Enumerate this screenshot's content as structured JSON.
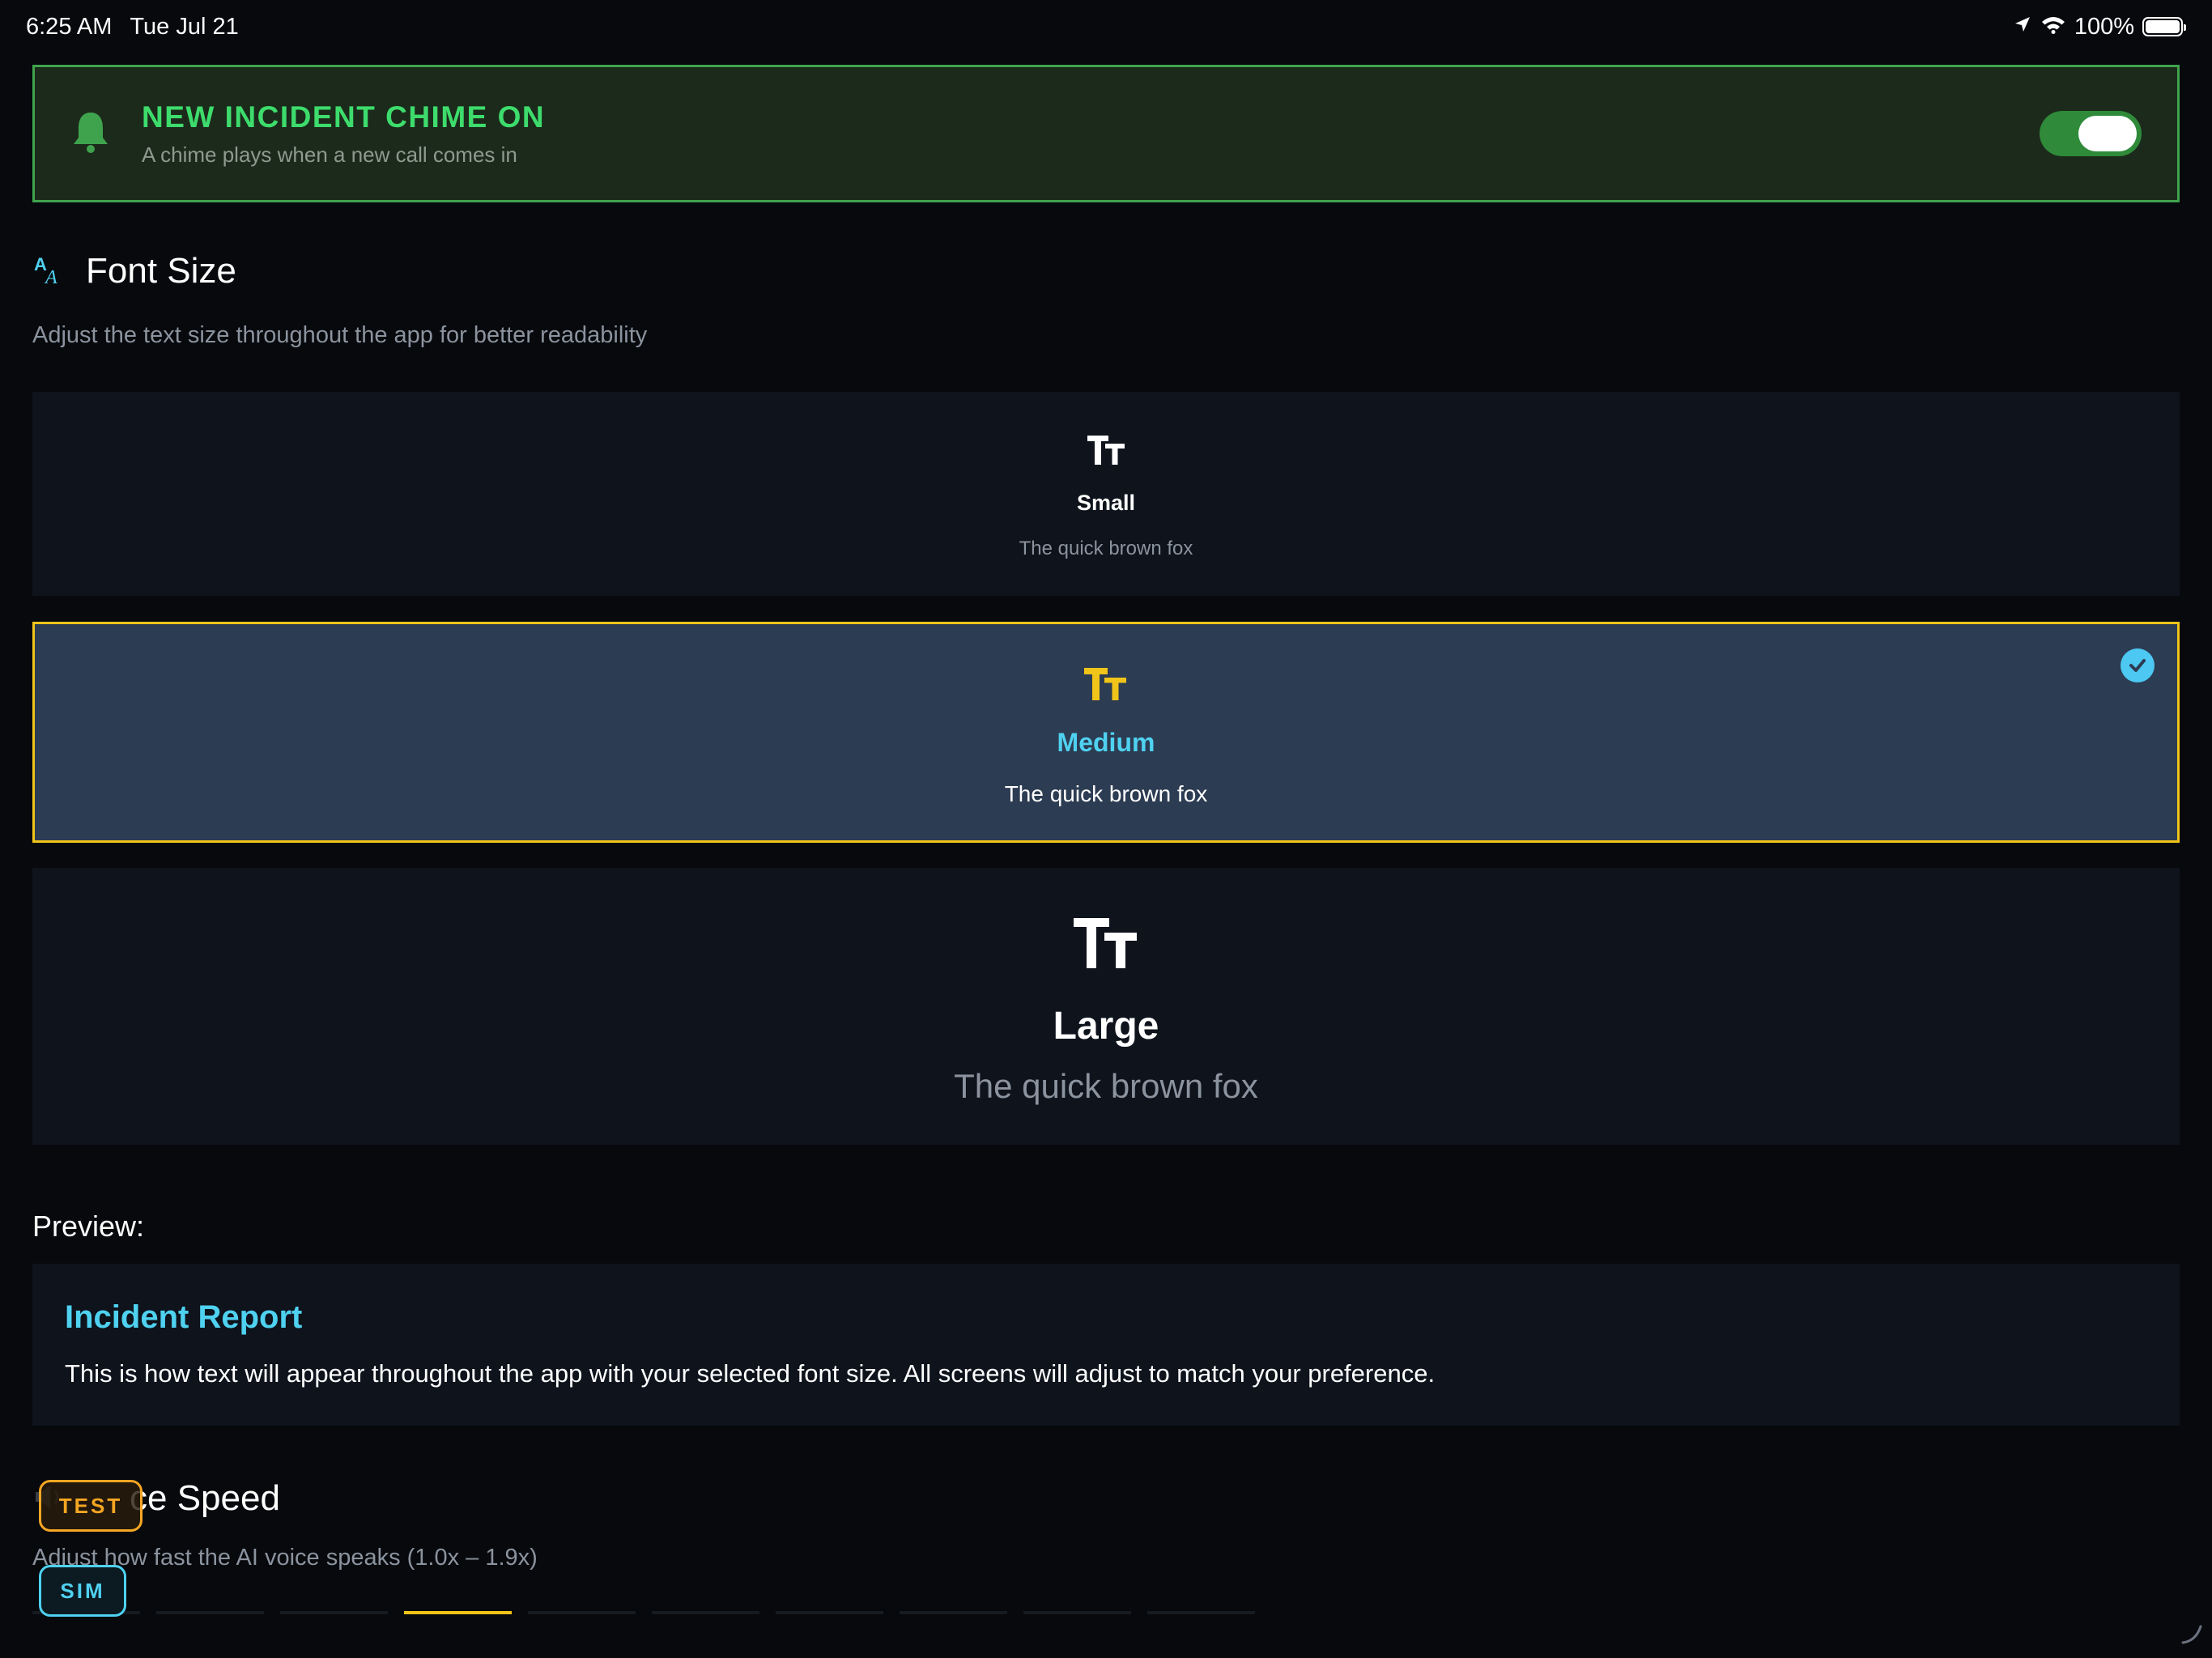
{
  "status_bar": {
    "time": "6:25 AM",
    "date": "Tue Jul 21",
    "battery": "100%",
    "icons": [
      "location-arrow-icon",
      "wifi-icon",
      "battery-icon"
    ]
  },
  "chime": {
    "title": "NEW INCIDENT CHIME ON",
    "subtitle": "A chime plays when a new call comes in",
    "enabled": true,
    "icon": "bell-icon",
    "accent": "#3ddc6c"
  },
  "font_size": {
    "title": "Font Size",
    "description": "Adjust the text size throughout the app for better readability",
    "icon": "font-size-icon",
    "options": [
      {
        "label": "Small",
        "sample": "The quick brown fox",
        "selected": false
      },
      {
        "label": "Medium",
        "sample": "The quick brown fox",
        "selected": true
      },
      {
        "label": "Large",
        "sample": "The quick brown fox",
        "selected": false
      }
    ],
    "selected_border": "#f0c419",
    "selected_label_color": "#4fd1f0"
  },
  "preview": {
    "label": "Preview:",
    "card_title": "Incident Report",
    "card_body": "This is how text will appear throughout the app with your selected font size. All screens will adjust to match your preference."
  },
  "voice_speed": {
    "title_visible": "ce Speed",
    "description": "Adjust how fast the AI voice speaks (1.0x – 1.9x)",
    "icon": "speaker-icon",
    "selected_segment": 3
  },
  "dev_badges": {
    "test": "TEST",
    "sim": "SIM"
  }
}
